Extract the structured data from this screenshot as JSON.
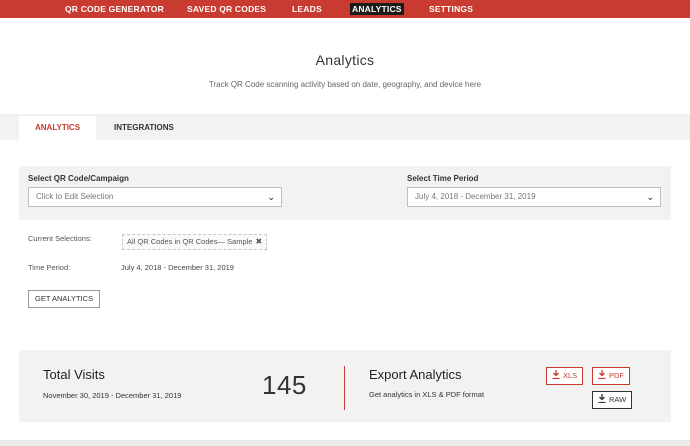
{
  "nav": {
    "items": [
      {
        "label": "QR CODE GENERATOR"
      },
      {
        "label": "SAVED QR CODES"
      },
      {
        "label": "LEADS"
      },
      {
        "label": "ANALYTICS"
      },
      {
        "label": "SETTINGS"
      }
    ],
    "active_label": "ANALYTICS"
  },
  "header": {
    "title": "Analytics",
    "subtitle": "Track QR Code scanning activity based on date, geography, and device here"
  },
  "tabs": [
    {
      "label": "ANALYTICS"
    },
    {
      "label": "INTEGRATIONS"
    }
  ],
  "filters": {
    "campaign_label": "Select QR Code/Campaign",
    "campaign_placeholder": "Click to Edit Selection",
    "period_label": "Select Time Period",
    "period_value": "July 4, 2018 - December 31, 2019"
  },
  "selections": {
    "current_label": "Current Selections:",
    "current_chip": "All QR Codes in QR Codes— Sample",
    "period_label": "Time Period:",
    "period_value": "July 4, 2018 - December 31, 2019",
    "button_label": "GET ANALYTICS"
  },
  "stats": {
    "title": "Total Visits",
    "range": "November 30, 2019 - December 31, 2019",
    "count": "145",
    "export_title": "Export Analytics",
    "export_sub": "Get analytics in XLS & PDF format",
    "btn_xls": "XLS",
    "btn_pdf": "PDF",
    "btn_raw": "RAW"
  },
  "colors": {
    "brand": "#c93a30",
    "nav_active_bg": "#1b1b1b",
    "panel_bg": "#f2f2f2"
  }
}
